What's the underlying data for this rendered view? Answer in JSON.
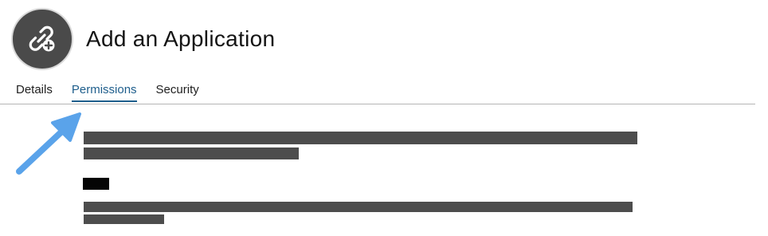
{
  "header": {
    "title": "Add an Application",
    "icon": "link-add-icon"
  },
  "tabs": [
    {
      "label": "Details",
      "active": false
    },
    {
      "label": "Permissions",
      "active": true
    },
    {
      "label": "Security",
      "active": false
    }
  ],
  "colors": {
    "active_tab": "#1e5e8c",
    "avatar_bg": "#4a4a4a",
    "annotation_arrow": "#5aa3ea",
    "redaction": "#4d4d4d"
  },
  "annotation": {
    "icon": "arrow-pointer-icon"
  }
}
